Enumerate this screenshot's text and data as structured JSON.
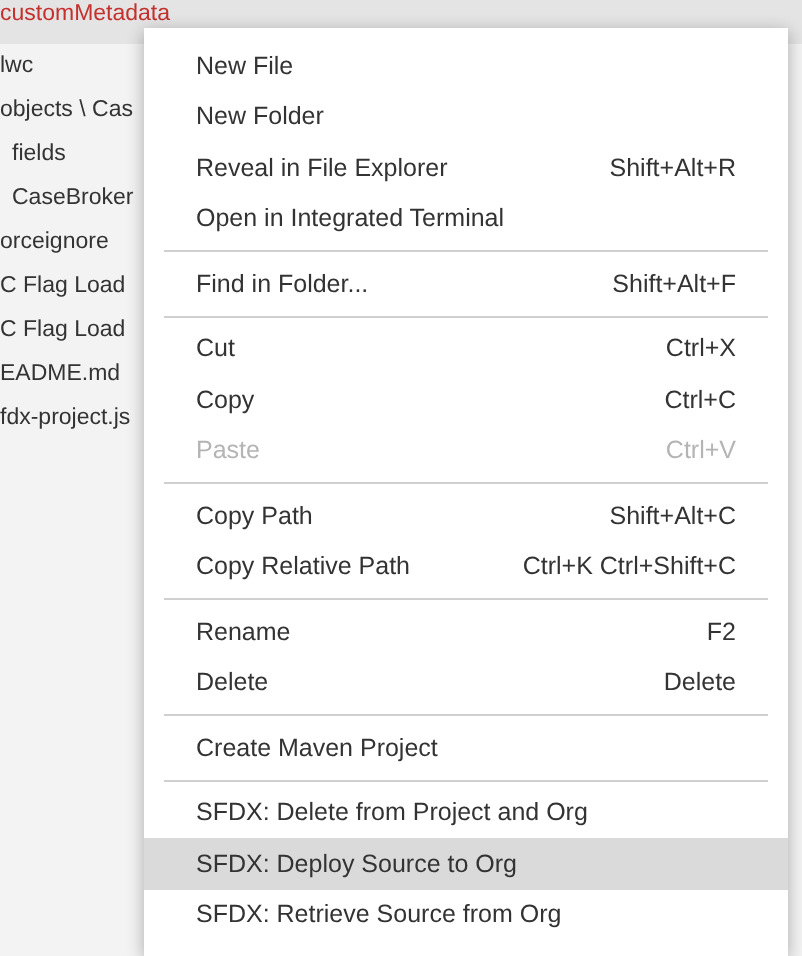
{
  "explorer": {
    "items": [
      {
        "label": "customMetadata",
        "selected": true,
        "color": "#c4302b"
      },
      {
        "label": "lwc",
        "selected": false,
        "color": "#333333"
      },
      {
        "label": "objects \\ Cas",
        "selected": false,
        "color": "#333333",
        "children": [
          {
            "label": "fields",
            "selected": false,
            "color": "#333333"
          },
          {
            "label": "CaseBroker",
            "selected": false,
            "color": "#333333"
          }
        ]
      },
      {
        "label": "orceignore",
        "selected": false,
        "color": "#333333"
      },
      {
        "label": "C Flag Load",
        "selected": false,
        "color": "#333333"
      },
      {
        "label": "C Flag Load",
        "selected": false,
        "color": "#333333"
      },
      {
        "label": "EADME.md",
        "selected": false,
        "color": "#333333"
      },
      {
        "label": "fdx-project.js",
        "selected": false,
        "color": "#333333"
      }
    ]
  },
  "context_menu": {
    "groups": [
      [
        {
          "label": "New File",
          "disabled": false,
          "selected": false
        },
        {
          "label": "New Folder",
          "disabled": false,
          "selected": false
        },
        {
          "label": "Reveal in File Explorer",
          "shortcut": "Shift+Alt+R",
          "disabled": false,
          "selected": false
        },
        {
          "label": "Open in Integrated Terminal",
          "disabled": false,
          "selected": false
        }
      ],
      [
        {
          "label": "Find in Folder...",
          "shortcut": "Shift+Alt+F",
          "disabled": false,
          "selected": false
        }
      ],
      [
        {
          "label": "Cut",
          "shortcut": "Ctrl+X",
          "disabled": false,
          "selected": false
        },
        {
          "label": "Copy",
          "shortcut": "Ctrl+C",
          "disabled": false,
          "selected": false
        },
        {
          "label": "Paste",
          "shortcut": "Ctrl+V",
          "disabled": true,
          "selected": false
        }
      ],
      [
        {
          "label": "Copy Path",
          "shortcut": "Shift+Alt+C",
          "disabled": false,
          "selected": false
        },
        {
          "label": "Copy Relative Path",
          "shortcut": "Ctrl+K Ctrl+Shift+C",
          "disabled": false,
          "selected": false
        }
      ],
      [
        {
          "label": "Rename",
          "shortcut": "F2",
          "disabled": false,
          "selected": false
        },
        {
          "label": "Delete",
          "shortcut": "Delete",
          "disabled": false,
          "selected": false
        }
      ],
      [
        {
          "label": "Create Maven Project",
          "disabled": false,
          "selected": false
        }
      ],
      [
        {
          "label": "SFDX: Delete from Project and Org",
          "disabled": false,
          "selected": false
        },
        {
          "label": "SFDX: Deploy Source to Org",
          "disabled": false,
          "selected": true
        },
        {
          "label": "SFDX: Retrieve Source from Org",
          "disabled": false,
          "selected": false
        }
      ]
    ]
  }
}
